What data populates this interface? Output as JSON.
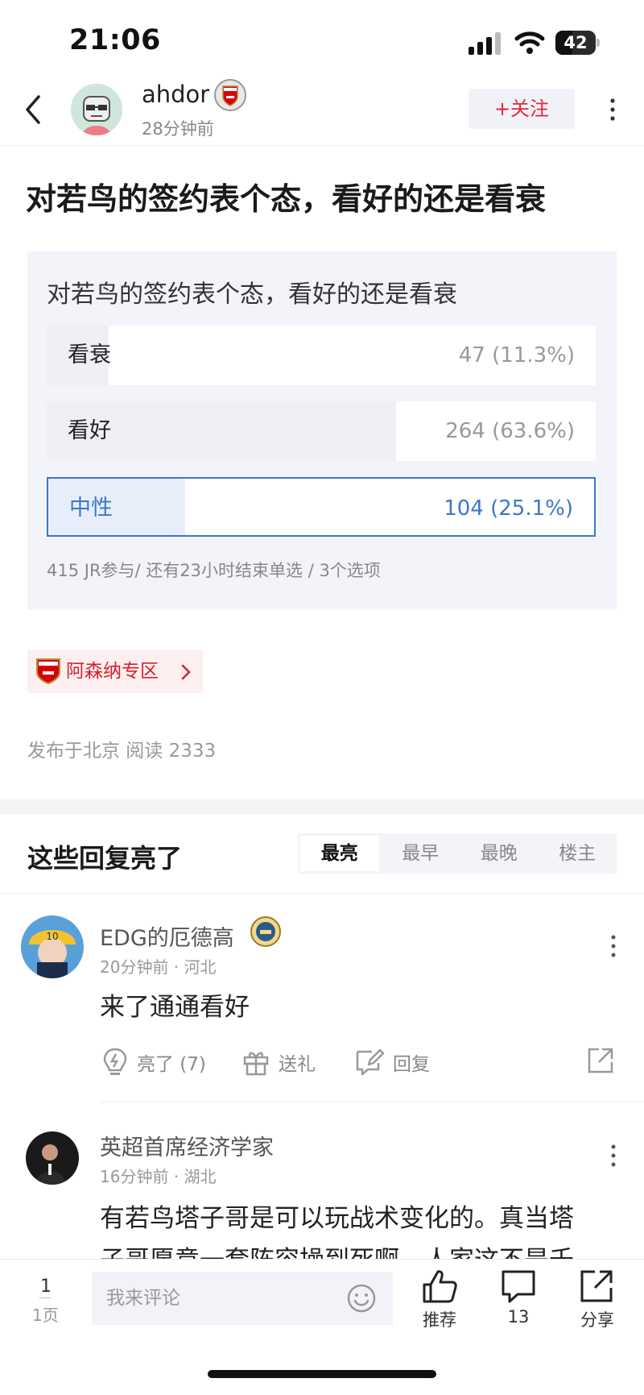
{
  "status_bar": {
    "time": "21:06",
    "battery": "42",
    "battery_level": 0.42
  },
  "header": {
    "author": "ahdor",
    "post_time": "28分钟前",
    "follow_label": "+关注"
  },
  "post": {
    "title": "对若鸟的签约表个态，看好的还是看衰"
  },
  "poll": {
    "question": "对若鸟的签约表个态，看好的还是看衰",
    "options": [
      {
        "label": "看衰",
        "count": "47 (11.3%)",
        "percent": 11.3,
        "selected": false
      },
      {
        "label": "看好",
        "count": "264 (63.6%)",
        "percent": 63.6,
        "selected": false
      },
      {
        "label": "中性",
        "count": "104 (25.1%)",
        "percent": 25.1,
        "selected": true
      }
    ],
    "meta": "415 JR参与/  还有23小时结束单选  /  3个选项"
  },
  "zone": {
    "label": "阿森纳专区"
  },
  "post_meta": "发布于北京   阅读 2333",
  "replies": {
    "title": "这些回复亮了",
    "sort_tabs": [
      "最亮",
      "最早",
      "最晚",
      "楼主"
    ],
    "comments": [
      {
        "name": "EDG的厄德高",
        "meta": "20分钟前 · 河北",
        "body": "来了通通看好",
        "like_label": "亮了 (7)",
        "gift_label": "送礼",
        "reply_label": "回复"
      },
      {
        "name": "英超首席经济学家",
        "meta": "16分钟前 · 湖北",
        "body_line1": "有若鸟塔子哥是可以玩战术变化的。真当塔",
        "body_line2": "子哥愿意一套阵容操到死啊，人家这不是千"
      }
    ]
  },
  "bottom_bar": {
    "page_num": "1",
    "page_label": "1页",
    "comment_placeholder": "我来评论",
    "recommend_label": "推荐",
    "comment_count": "13",
    "share_label": "分享"
  },
  "colors": {
    "accent": "#e0283a",
    "poll_selected": "#3b78c8",
    "zone_red": "#d1222f"
  }
}
